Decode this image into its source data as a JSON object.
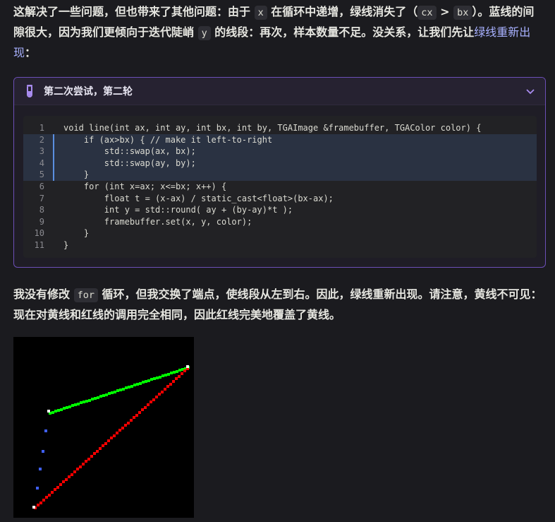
{
  "intro": {
    "t1": "这解决了一些问题，但也带来了其他问题：由于 ",
    "c1": "x",
    "t2": " 在循环中递增，绿线消失了（",
    "c2": "cx",
    "t3": " > ",
    "c3": "bx",
    "t4": "）。蓝线的间隙很大，因为我们更倾向于迭代陡峭 ",
    "c4": "y",
    "t5": " 的线段：再次，样本数量不足。没关系，让我们先让",
    "link": "绿线重新出现",
    "t6": "："
  },
  "callout": {
    "title": "第二次尝试，第二轮",
    "icon": "test-tube-icon",
    "accent": "#6c4fb7"
  },
  "code": {
    "lines": [
      {
        "n": "1",
        "text": "void line(int ax, int ay, int bx, int by, TGAImage &framebuffer, TGAColor color) {"
      },
      {
        "n": "2",
        "text": "    if (ax>bx) { // make it left-to-right"
      },
      {
        "n": "3",
        "text": "        std::swap(ax, bx);"
      },
      {
        "n": "4",
        "text": "        std::swap(ay, by);"
      },
      {
        "n": "5",
        "text": "    }"
      },
      {
        "n": "6",
        "text": "    for (int x=ax; x<=bx; x++) {"
      },
      {
        "n": "7",
        "text": "        float t = (x-ax) / static_cast<float>(bx-ax);"
      },
      {
        "n": "8",
        "text": "        int y = std::round( ay + (by-ay)*t );"
      },
      {
        "n": "9",
        "text": "        framebuffer.set(x, y, color);"
      },
      {
        "n": "10",
        "text": "    }"
      },
      {
        "n": "11",
        "text": "}"
      }
    ],
    "highlighted": [
      "2",
      "3",
      "4",
      "5"
    ]
  },
  "outro": {
    "t1": "我没有修改 ",
    "c1": "for",
    "t2": " 循环，但我交换了端点，使线段从左到右。因此，绿线重新出现。请注意，黄线不可见：现在对黄线和红线的调用完全相同，因此红线完美地覆盖了黄线。"
  },
  "colors": {
    "green": "#00ff00",
    "red": "#ff0000",
    "blue": "#4060ff",
    "white": "#ffffff"
  }
}
